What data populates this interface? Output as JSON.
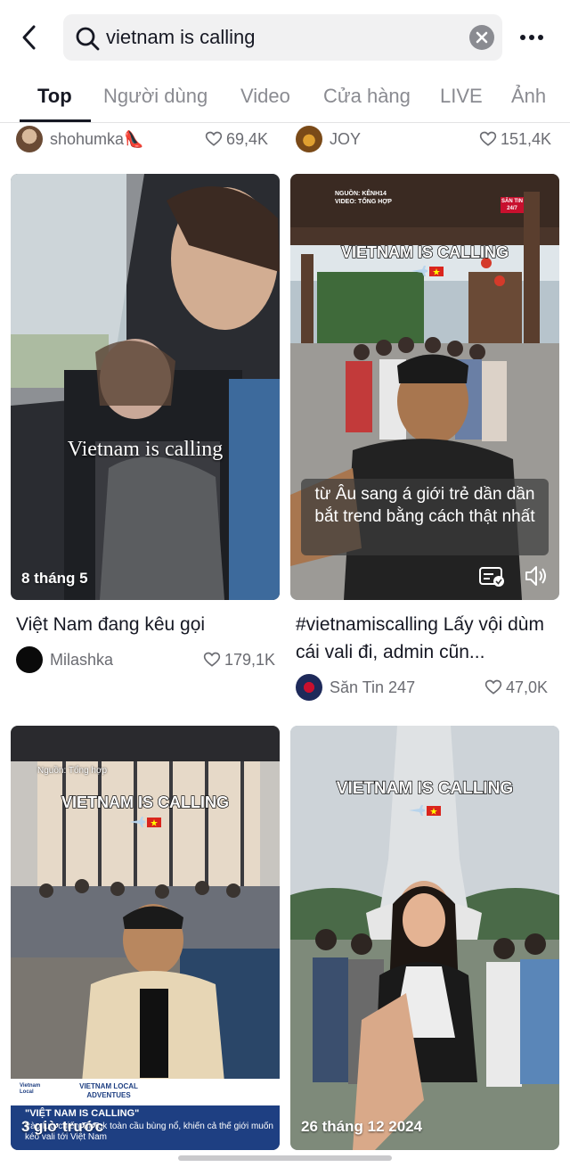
{
  "search": {
    "query": "vietnam is calling"
  },
  "tabs": [
    "Top",
    "Người dùng",
    "Video",
    "Cửa hàng",
    "LIVE",
    "Ảnh"
  ],
  "active_tab": "Top",
  "partial_row": {
    "left": {
      "author": "shohumka👠",
      "likes": "69,4K"
    },
    "right": {
      "author": "JOY",
      "likes": "151,4K"
    }
  },
  "cards": [
    {
      "overlay": "Vietnam is calling",
      "date": "8 tháng 5",
      "title": "Việt Nam đang kêu gọi",
      "author": "Milashka",
      "likes": "179,1K"
    },
    {
      "overlay": "VIETNAM IS CALLING",
      "source_top": "NGUỒN: KÊNH14",
      "source_sub": "VIDEO: TỔNG HỢP",
      "badge": "SĂN TIN 24/7",
      "caption": "từ Âu sang á giới trẻ dần dần bắt trend bằng cách thật nhất",
      "title": "#vietnamiscalling Lấy vội dùm cái vali đi, admin cũn...",
      "author": "Săn Tin 247",
      "likes": "47,0K"
    },
    {
      "overlay": "VIETNAM IS CALLING",
      "source_top": "Nguồn: Tổng hợp",
      "brand": "VIETNAM LOCAL ADVENTUES",
      "banner_title": "\"VIỆT NAM IS CALLING\"",
      "banner_text": "trào lưu chiến TikTok toàn cầu bùng nổ, khiến cả thế giới muốn kéo vali tới Việt Nam",
      "date": "3 giờ trước"
    },
    {
      "overlay": "VIETNAM IS CALLING",
      "date": "26 tháng 12 2024"
    }
  ],
  "colors": {
    "text": "#161823",
    "muted": "#8a8b91",
    "search_bg": "#f1f1f2",
    "vn_red": "#da251d",
    "vn_yellow": "#ffff00"
  },
  "icons": [
    "back-arrow-icon",
    "search-icon",
    "clear-icon",
    "more-icon",
    "heart-icon",
    "caption-icon",
    "speaker-icon",
    "airplane-icon",
    "vietnam-flag-icon"
  ]
}
